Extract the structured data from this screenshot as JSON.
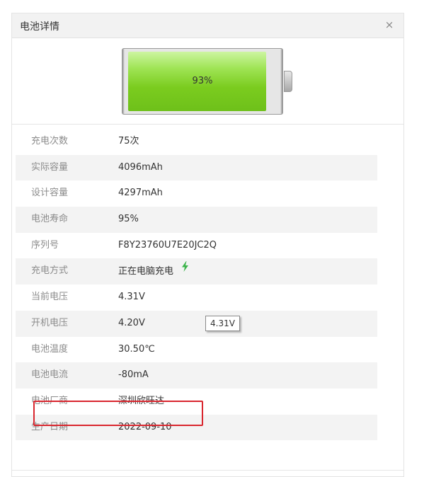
{
  "window": {
    "title": "电池详情",
    "close_label": "×"
  },
  "battery": {
    "level_text": "93%",
    "level_fraction": 0.93,
    "fill_color": "#7bcc1f"
  },
  "info_rows": [
    {
      "label": "充电次数",
      "value": "75次"
    },
    {
      "label": "实际容量",
      "value": "4096mAh"
    },
    {
      "label": "设计容量",
      "value": "4297mAh"
    },
    {
      "label": "电池寿命",
      "value": "95%"
    },
    {
      "label": "序列号",
      "value": "F8Y23760U7E20JC2Q"
    },
    {
      "label": "充电方式",
      "value": "正在电脑充电",
      "icon": "lightning-bolt-icon"
    },
    {
      "label": "当前电压",
      "value": "4.31V"
    },
    {
      "label": "开机电压",
      "value": "4.20V"
    },
    {
      "label": "电池温度",
      "value": "30.50℃"
    },
    {
      "label": "电池电流",
      "value": "-80mA"
    },
    {
      "label": "电池厂商",
      "value": "深圳欣旺达"
    },
    {
      "label": "生产日期",
      "value": "2022-09-10"
    }
  ],
  "tooltip": {
    "text": "4.31V"
  },
  "colors": {
    "highlight_border": "#d9262e",
    "bolt": "#3cb44b"
  }
}
